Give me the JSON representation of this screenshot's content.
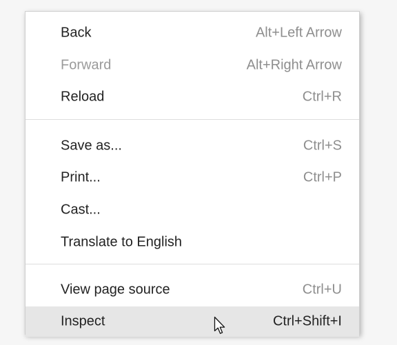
{
  "menu": {
    "items": [
      {
        "label": "Back",
        "shortcut": "Alt+Left Arrow"
      },
      {
        "label": "Forward",
        "shortcut": "Alt+Right Arrow"
      },
      {
        "label": "Reload",
        "shortcut": "Ctrl+R"
      },
      {
        "label": "Save as...",
        "shortcut": "Ctrl+S"
      },
      {
        "label": "Print...",
        "shortcut": "Ctrl+P"
      },
      {
        "label": "Cast...",
        "shortcut": ""
      },
      {
        "label": "Translate to English",
        "shortcut": ""
      },
      {
        "label": "View page source",
        "shortcut": "Ctrl+U"
      },
      {
        "label": "Inspect",
        "shortcut": "Ctrl+Shift+I"
      }
    ]
  },
  "states": {
    "disabled_item": "Forward",
    "highlighted_item": "Inspect"
  },
  "icons": {
    "cursor": "arrow-pointer-icon"
  },
  "colors": {
    "menu_background": "#ffffff",
    "highlight_background": "#e6e6e6",
    "shortcut_text": "#8e8e8e",
    "disabled_text": "#9a9a9a"
  }
}
